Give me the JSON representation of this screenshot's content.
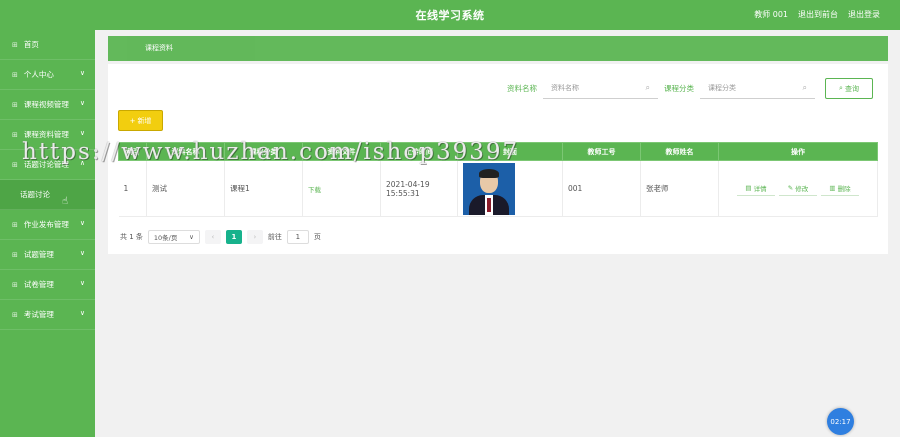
{
  "header": {
    "title": "在线学习系统",
    "user": "教师 001",
    "back_to_console": "退出到前台",
    "logout": "退出登录"
  },
  "sidebar": {
    "items": [
      {
        "label": "首页",
        "chevron": false
      },
      {
        "label": "个人中心",
        "chevron": true
      },
      {
        "label": "课程视频管理",
        "chevron": true
      },
      {
        "label": "课程资料管理",
        "chevron": true
      },
      {
        "label": "话题讨论管理",
        "chevron": true
      },
      {
        "label": "话题讨论",
        "chevron": false,
        "sub": true
      },
      {
        "label": "作业发布管理",
        "chevron": true
      },
      {
        "label": "试题管理",
        "chevron": true
      },
      {
        "label": "试卷管理",
        "chevron": true
      },
      {
        "label": "考试管理",
        "chevron": true
      }
    ]
  },
  "breadcrumb": "课程资料",
  "search": {
    "label1": "资料名称",
    "placeholder1": "资料名称",
    "label2": "课程分类",
    "placeholder2": "课程分类",
    "button": "查询"
  },
  "add_button": "新增",
  "table": {
    "headers": [
      "索引",
      "资料名称",
      "课程分类",
      "资料文件",
      "上传时间",
      "封面",
      "教师工号",
      "教师姓名",
      "操作"
    ],
    "rows": [
      {
        "index": "1",
        "name": "测试",
        "category": "课程1",
        "file": "下载",
        "time": "2021-04-19 15:55:31",
        "teacher_id": "001",
        "teacher_name": "张老师"
      }
    ],
    "ops": {
      "detail": "详情",
      "edit": "修改",
      "delete": "删除"
    }
  },
  "pager": {
    "total": "共 1 条",
    "page_size": "10条/页",
    "current": "1",
    "goto": "前往",
    "goto_value": "1",
    "page_unit": "页"
  },
  "watermark": "https://www.huzhan.com/ishop39397",
  "timer": "02:17",
  "colors": {
    "primary": "#5bb552",
    "accent": "#17b28c",
    "add": "#f2ce0f"
  }
}
